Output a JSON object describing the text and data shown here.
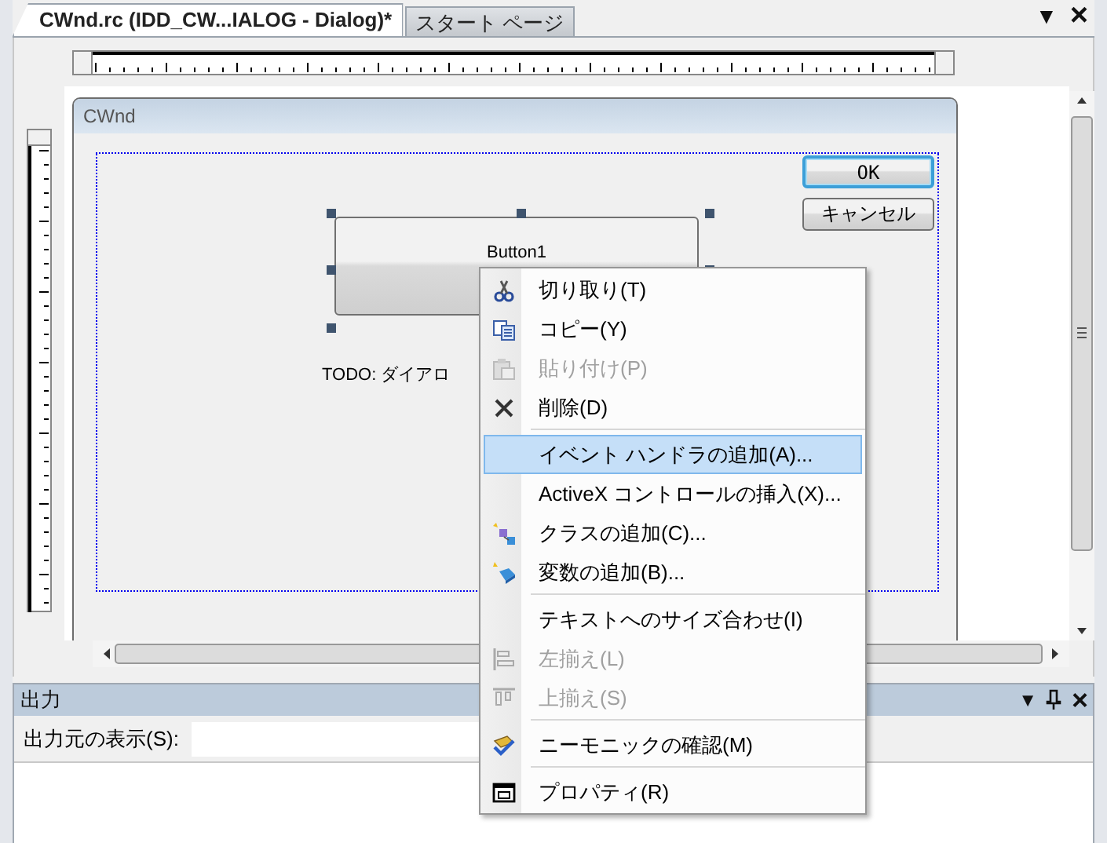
{
  "document_tabs": [
    {
      "label": "CWnd.rc (IDD_CW...IALOG - Dialog)*",
      "selected": true
    },
    {
      "label": "スタート ページ",
      "selected": false
    }
  ],
  "tab_strip_buttons": [
    "▼",
    "×"
  ],
  "dialog": {
    "title": "CWnd",
    "buttons": [
      {
        "label": "OK",
        "focused": true
      },
      {
        "label": "キャンセル",
        "focused": false
      }
    ],
    "controls": [
      {
        "kind": "button",
        "label": "Button1",
        "selected": true
      },
      {
        "kind": "static",
        "label": "TODO: ダイアロ",
        "selected": false
      }
    ]
  },
  "context_menu": {
    "items": [
      {
        "kind": "item",
        "label": "切り取り(T)",
        "disabled": false,
        "selected": false
      },
      {
        "kind": "item",
        "label": "コピー(Y)",
        "disabled": false,
        "selected": false
      },
      {
        "kind": "item",
        "label": "貼り付け(P)",
        "disabled": true,
        "selected": false
      },
      {
        "kind": "item",
        "label": "削除(D)",
        "disabled": false,
        "selected": false
      },
      {
        "kind": "separator"
      },
      {
        "kind": "item",
        "label": "イベント ハンドラの追加(A)...",
        "disabled": false,
        "selected": true
      },
      {
        "kind": "item",
        "label": "ActiveX コントロールの挿入(X)...",
        "disabled": false,
        "selected": false
      },
      {
        "kind": "item",
        "label": "クラスの追加(C)...",
        "disabled": false,
        "selected": false
      },
      {
        "kind": "item",
        "label": "変数の追加(B)...",
        "disabled": false,
        "selected": false
      },
      {
        "kind": "separator"
      },
      {
        "kind": "item",
        "label": "テキストへのサイズ合わせ(I)",
        "disabled": false,
        "selected": false
      },
      {
        "kind": "item",
        "label": "左揃え(L)",
        "disabled": true,
        "selected": false
      },
      {
        "kind": "item",
        "label": "上揃え(S)",
        "disabled": true,
        "selected": false
      },
      {
        "kind": "separator"
      },
      {
        "kind": "item",
        "label": "ニーモニックの確認(M)",
        "disabled": false,
        "selected": false
      },
      {
        "kind": "separator"
      },
      {
        "kind": "item",
        "label": "プロパティ(R)",
        "disabled": false,
        "selected": false
      }
    ]
  },
  "output_panel": {
    "title": "出力",
    "buttons": [
      "▼",
      "×"
    ],
    "source_label": "出力元の表示(S):"
  }
}
